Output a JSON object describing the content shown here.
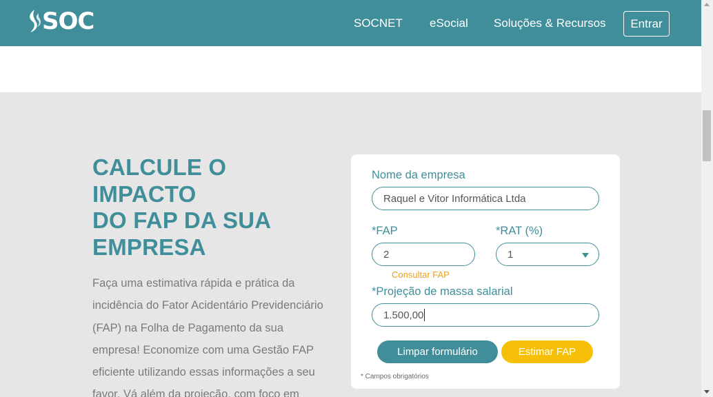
{
  "header": {
    "logo_text": "SOC",
    "nav": [
      "SOCNET",
      "eSocial",
      "Soluções & Recursos"
    ],
    "login_label": "Entrar"
  },
  "hero": {
    "headline_lines": [
      "CALCULE O",
      "IMPACTO",
      "DO FAP DA SUA",
      "EMPRESA"
    ],
    "intro_lines": [
      "Faça uma estimativa rápida e prática da",
      "incidência do Fator Acidentário Previdenciário",
      "(FAP) na Folha de Pagamento da sua",
      "empresa! Economize com uma Gestão FAP",
      "eficiente utilizando essas informações a seu",
      "favor. Vá além da projeção, com foco em"
    ]
  },
  "form": {
    "company_label": "Nome da empresa",
    "company_value": "Raquel e Vitor Informática Ltda",
    "fap_label": "*FAP",
    "fap_value": "2",
    "rat_label": "*RAT (%)",
    "rat_value": "1",
    "consult_fap_link": "Consultar FAP",
    "payroll_label": "*Projeção de massa salarial",
    "payroll_value": "1.500,00",
    "clear_button": "Limpar formulário",
    "estimate_button": "Estimar FAP",
    "required_note": "* Campos obrigatórios"
  },
  "colors": {
    "brand_teal": "#3f8e99",
    "accent_yellow": "#f7c008",
    "link_orange": "#e8a11c",
    "page_background": "#e6e6e6"
  }
}
